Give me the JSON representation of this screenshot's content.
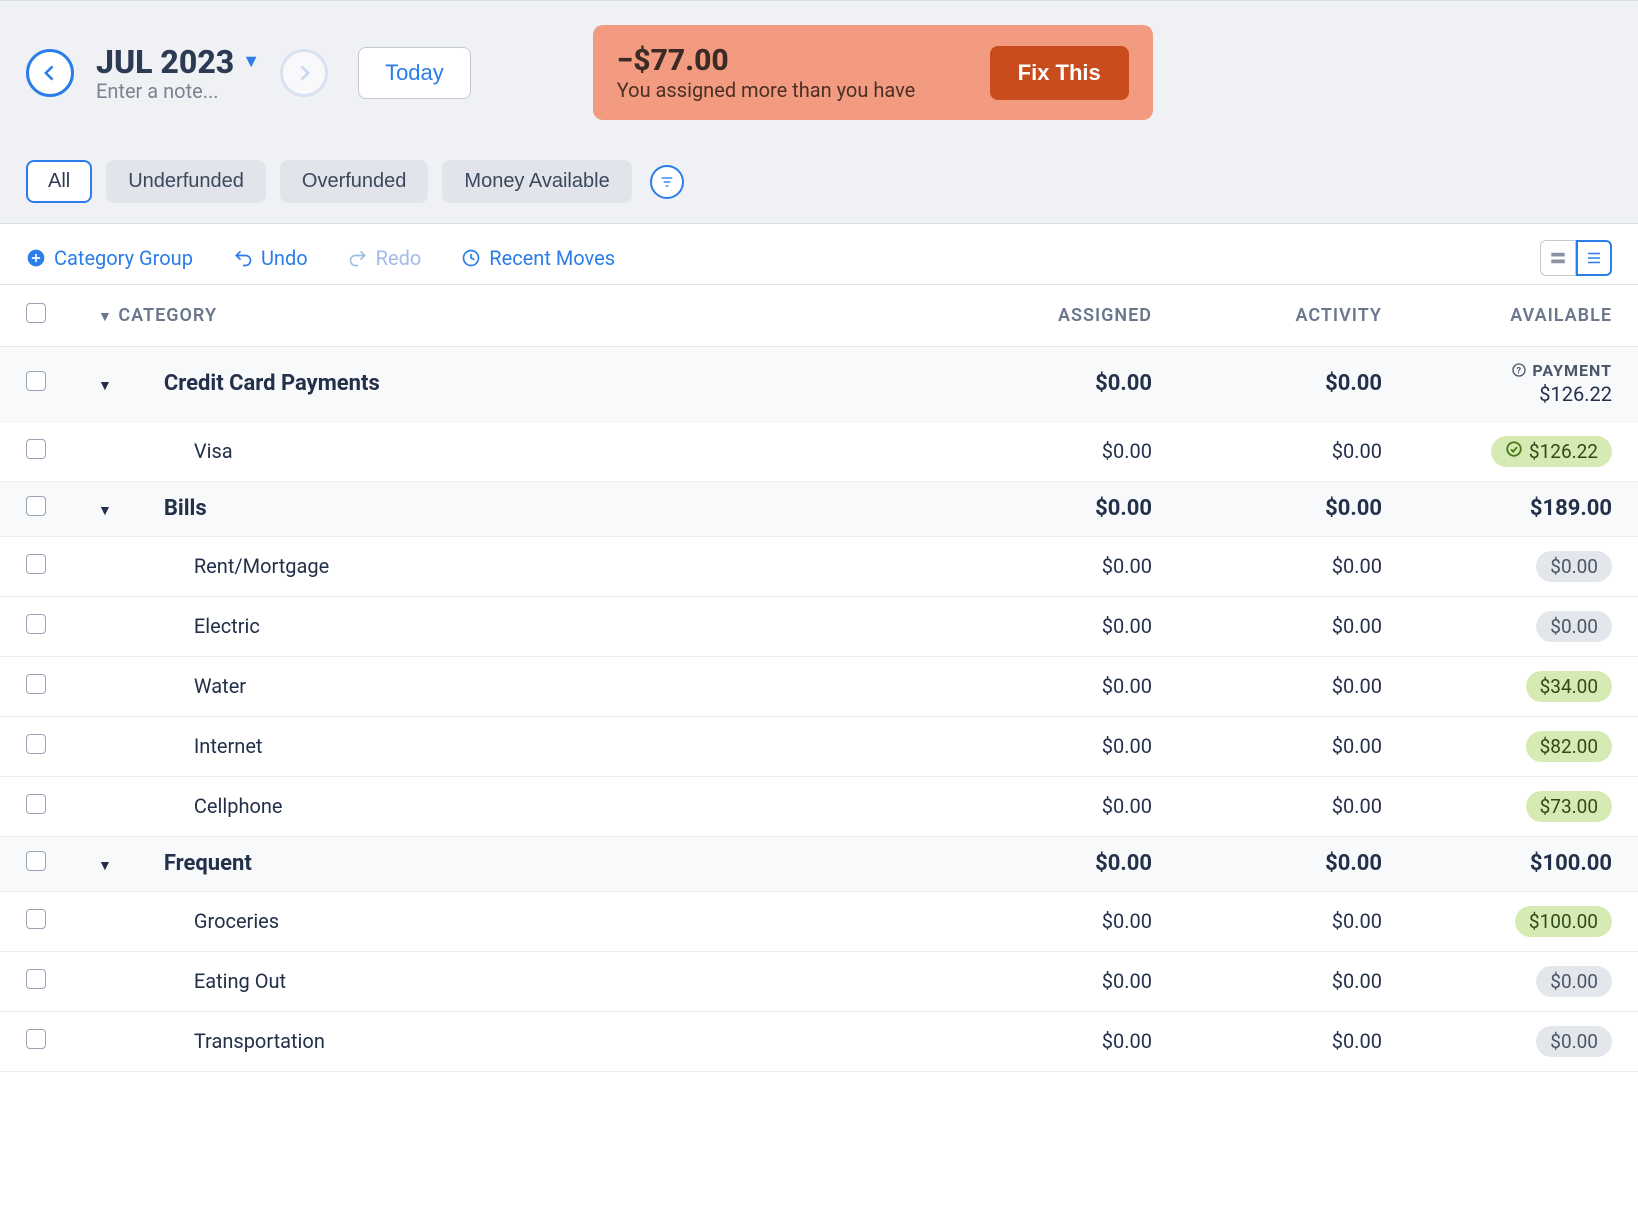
{
  "header": {
    "month_label": "JUL 2023",
    "note_placeholder": "Enter a note...",
    "today_label": "Today"
  },
  "alert": {
    "amount": "−$77.00",
    "message": "You assigned more than you have",
    "fix_label": "Fix This"
  },
  "filters": {
    "all": "All",
    "underfunded": "Underfunded",
    "overfunded": "Overfunded",
    "money_available": "Money Available"
  },
  "toolbar": {
    "category_group": "Category Group",
    "undo": "Undo",
    "redo": "Redo",
    "recent_moves": "Recent Moves"
  },
  "columns": {
    "category": "CATEGORY",
    "assigned": "ASSIGNED",
    "activity": "ACTIVITY",
    "available": "AVAILABLE"
  },
  "payment_label": "PAYMENT",
  "groups": [
    {
      "name": "Credit Card Payments",
      "assigned": "$0.00",
      "activity": "$0.00",
      "available": "$126.22",
      "available_is_payment": true,
      "rows": [
        {
          "name": "Visa",
          "assigned": "$0.00",
          "activity": "$0.00",
          "available": "$126.22",
          "status": "green_check"
        }
      ]
    },
    {
      "name": "Bills",
      "assigned": "$0.00",
      "activity": "$0.00",
      "available": "$189.00",
      "rows": [
        {
          "name": "Rent/Mortgage",
          "assigned": "$0.00",
          "activity": "$0.00",
          "available": "$0.00",
          "status": "gray"
        },
        {
          "name": "Electric",
          "assigned": "$0.00",
          "activity": "$0.00",
          "available": "$0.00",
          "status": "gray"
        },
        {
          "name": "Water",
          "assigned": "$0.00",
          "activity": "$0.00",
          "available": "$34.00",
          "status": "green"
        },
        {
          "name": "Internet",
          "assigned": "$0.00",
          "activity": "$0.00",
          "available": "$82.00",
          "status": "green"
        },
        {
          "name": "Cellphone",
          "assigned": "$0.00",
          "activity": "$0.00",
          "available": "$73.00",
          "status": "green"
        }
      ]
    },
    {
      "name": "Frequent",
      "assigned": "$0.00",
      "activity": "$0.00",
      "available": "$100.00",
      "rows": [
        {
          "name": "Groceries",
          "assigned": "$0.00",
          "activity": "$0.00",
          "available": "$100.00",
          "status": "green"
        },
        {
          "name": "Eating Out",
          "assigned": "$0.00",
          "activity": "$0.00",
          "available": "$0.00",
          "status": "gray"
        },
        {
          "name": "Transportation",
          "assigned": "$0.00",
          "activity": "$0.00",
          "available": "$0.00",
          "status": "gray"
        }
      ]
    }
  ]
}
